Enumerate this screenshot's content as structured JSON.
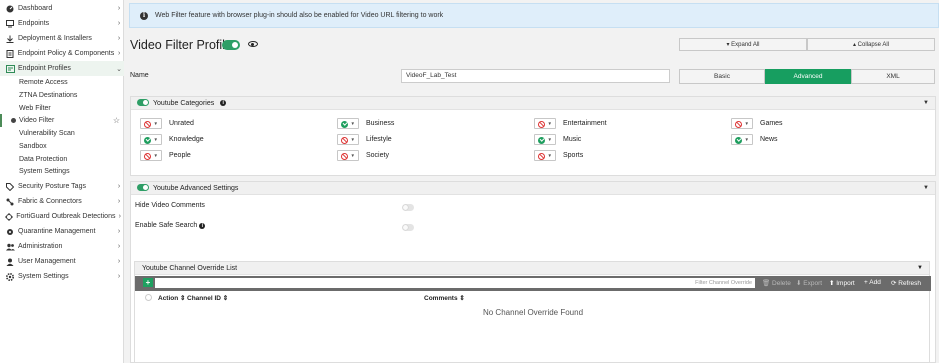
{
  "sidebar": {
    "items": [
      {
        "label": "Dashboard"
      },
      {
        "label": "Endpoints"
      },
      {
        "label": "Deployment & Installers"
      },
      {
        "label": "Endpoint Policy & Components"
      },
      {
        "label": "Endpoint Profiles"
      },
      {
        "label": "Security Posture Tags"
      },
      {
        "label": "Fabric & Connectors"
      },
      {
        "label": "FortiGuard Outbreak Detections"
      },
      {
        "label": "Quarantine Management"
      },
      {
        "label": "Administration"
      },
      {
        "label": "User Management"
      },
      {
        "label": "System Settings"
      }
    ],
    "sub_items": [
      {
        "label": "Remote Access"
      },
      {
        "label": "ZTNA Destinations"
      },
      {
        "label": "Web Filter"
      },
      {
        "label": "Video Filter"
      },
      {
        "label": "Vulnerability Scan"
      },
      {
        "label": "Sandbox"
      },
      {
        "label": "Data Protection"
      },
      {
        "label": "System Settings"
      }
    ]
  },
  "banner": {
    "text": "Web Filter feature with browser plug-in should also be enabled for Video URL filtering to work"
  },
  "header": {
    "title": "Video Filter Profile",
    "expand_all": "▾ Expand All",
    "collapse_all": "▴ Collapse All"
  },
  "name_row": {
    "label": "Name",
    "value": "VideoF_Lab_Test"
  },
  "mode_tabs": [
    {
      "label": "Basic"
    },
    {
      "label": "Advanced"
    },
    {
      "label": "XML"
    }
  ],
  "categories_panel": {
    "title": "Youtube Categories",
    "items": [
      {
        "label": "Unrated",
        "action": "block"
      },
      {
        "label": "Business",
        "action": "allow"
      },
      {
        "label": "Entertainment",
        "action": "block"
      },
      {
        "label": "Games",
        "action": "block"
      },
      {
        "label": "Knowledge",
        "action": "allow"
      },
      {
        "label": "Lifestyle",
        "action": "block"
      },
      {
        "label": "Music",
        "action": "allow"
      },
      {
        "label": "News",
        "action": "allow"
      },
      {
        "label": "People",
        "action": "block"
      },
      {
        "label": "Society",
        "action": "block"
      },
      {
        "label": "Sports",
        "action": "block"
      }
    ]
  },
  "advanced_panel": {
    "title": "Youtube Advanced Settings",
    "hide_comments": "Hide Video Comments",
    "safe_search": "Enable Safe Search",
    "safe_search_info": "i"
  },
  "override": {
    "title": "Youtube Channel Override List",
    "add": "+",
    "filter_placeholder": "Filter Channel Override",
    "delete": "🗑 Delete",
    "export": "⬇ Export",
    "import": "⬆ Import",
    "add_label": "+ Add",
    "refresh": "⟳ Refresh",
    "columns": {
      "action": "Action ⇕",
      "channel_id": "Channel ID ⇕",
      "comments": "Comments ⇕"
    },
    "empty": "No Channel Override Found"
  },
  "colors": {
    "accent": "#179e60",
    "block": "#dd3333",
    "banner_bg": "#dfeefa"
  }
}
